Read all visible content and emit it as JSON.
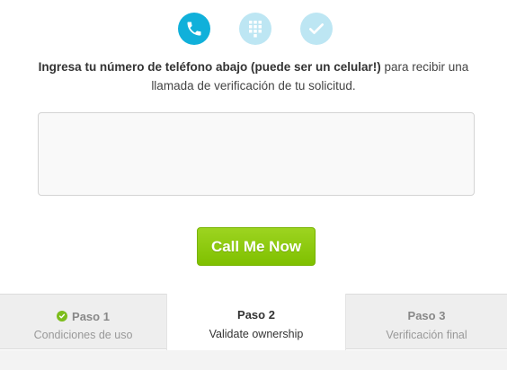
{
  "progress_icons": [
    "phone-icon",
    "keypad-icon",
    "check-icon"
  ],
  "colors": {
    "active_circle": "#10b0da",
    "inactive_circle": "#bde6f3",
    "button_green": "#8cc814",
    "done_green": "#7dbd1c"
  },
  "instructions": {
    "bold": "Ingresa tu número de teléfono abajo (puede ser un celular!)",
    "rest_line1": " para recibir una",
    "line2": "llamada de verificación de tu solicitud."
  },
  "phone_input": {
    "value": "",
    "placeholder": ""
  },
  "call_button": {
    "label": "Call Me Now"
  },
  "steps": [
    {
      "title": "Paso 1",
      "subtitle": "Condiciones de uso",
      "status": "done"
    },
    {
      "title": "Paso 2",
      "subtitle": "Validate ownership",
      "status": "current"
    },
    {
      "title": "Paso 3",
      "subtitle": "Verificación final",
      "status": "pending"
    }
  ]
}
